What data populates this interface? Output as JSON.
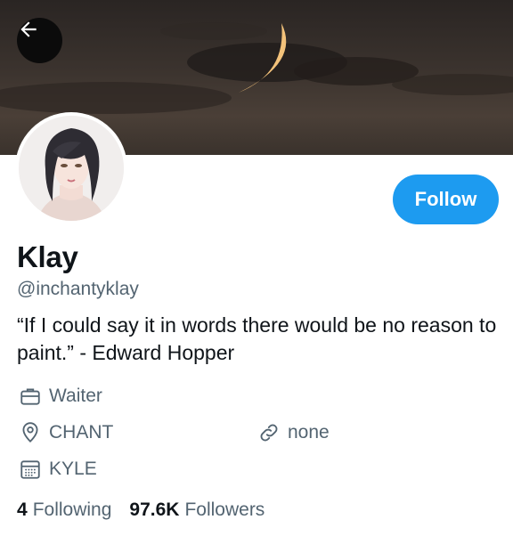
{
  "profile": {
    "name": "Klay",
    "handle": "@inchantyklay",
    "bio": "“If I could say it in words there would be no reason to paint.” - Edward Hopper",
    "occupation": "Waiter",
    "location": "CHANT",
    "website": "none",
    "joined": "KYLE",
    "following_count": "4",
    "following_label": "Following",
    "followers_count": "97.6K",
    "followers_label": "Followers"
  },
  "actions": {
    "follow_label": "Follow"
  },
  "icons": {
    "back": "back-arrow-icon",
    "occupation": "briefcase-icon",
    "location": "location-pin-icon",
    "website": "link-icon",
    "joined": "calendar-icon"
  },
  "colors": {
    "accent": "#1d9bf0",
    "secondary_text": "#536471",
    "primary_text": "#0f1419"
  }
}
